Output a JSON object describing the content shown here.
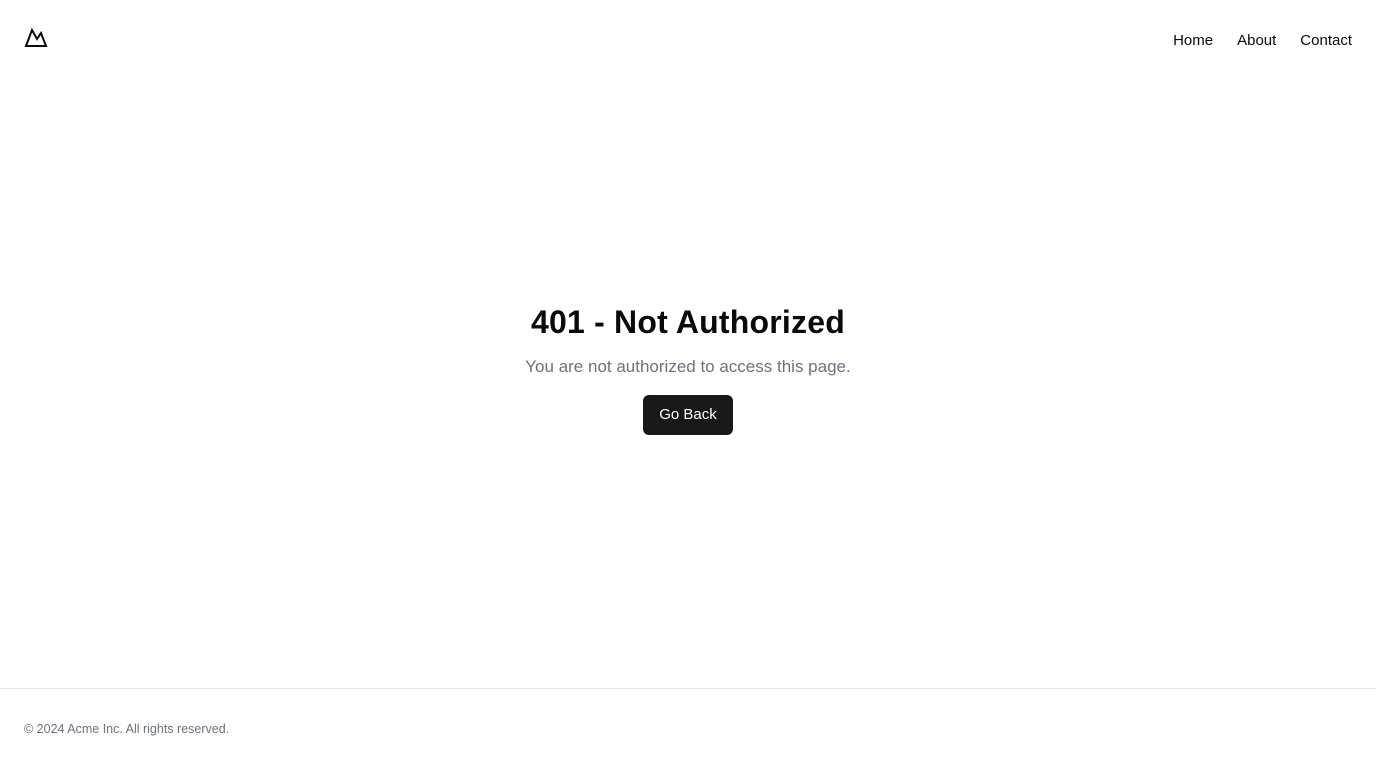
{
  "header": {
    "logo_icon": "mountain-icon",
    "nav": [
      {
        "label": "Home"
      },
      {
        "label": "About"
      },
      {
        "label": "Contact"
      }
    ]
  },
  "main": {
    "title": "401 - Not Authorized",
    "message": "You are not authorized to access this page.",
    "button_label": "Go Back"
  },
  "footer": {
    "copyright": "© 2024 Acme Inc. All rights reserved."
  },
  "colors": {
    "text": "#0a0a0a",
    "muted": "#6b7280",
    "button_bg": "#18181b",
    "button_text": "#ffffff",
    "border": "#e5e7eb"
  }
}
